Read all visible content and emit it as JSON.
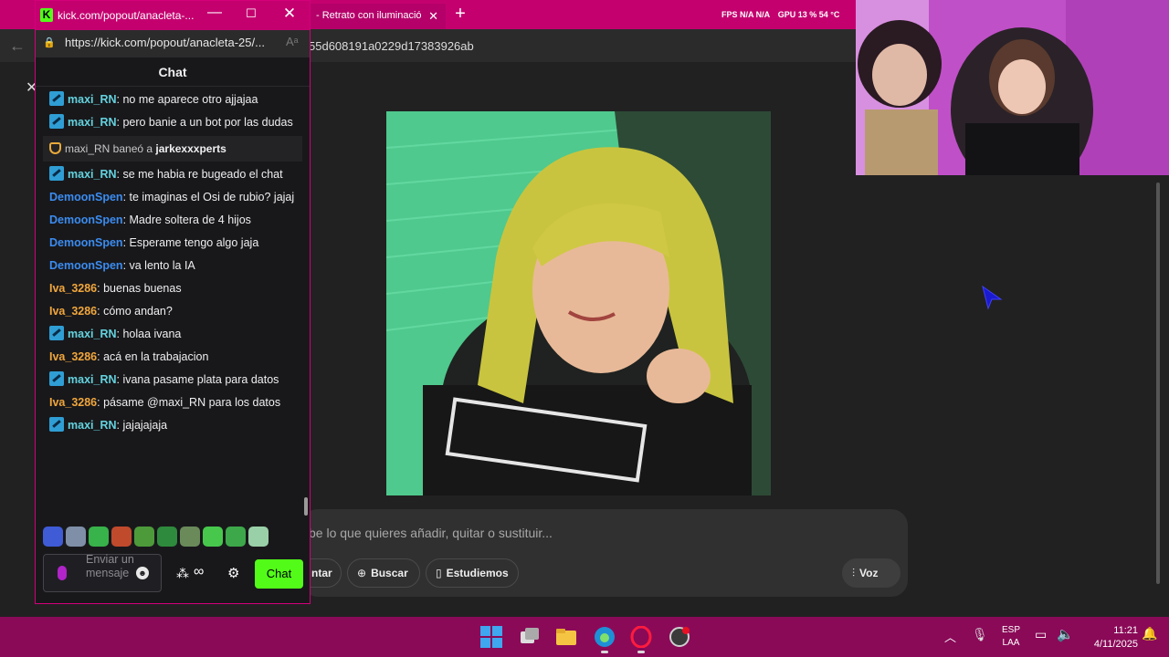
{
  "background_browser": {
    "tab_title": "- Retrato con iluminació",
    "perf_stats": [
      "FPS N/A N/A",
      "GPU 13 % 54 °C"
    ],
    "url_fragment": "55d608191a0229d17383926ab"
  },
  "prompt_bar": {
    "placeholder": "be lo que quieres añadir, quitar o sustituir...",
    "attach_label": "ntar",
    "search_label": "Buscar",
    "study_label": "Estudiemos",
    "voice_label": "Voz"
  },
  "popout": {
    "title": "kick.com/popout/anacleta-...",
    "url": "https://kick.com/popout/anacleta-25/...",
    "header": "Chat",
    "messages": [
      {
        "user": "maxi_RN",
        "text": ": no me aparece otro ajjajaa",
        "badge": true,
        "color": "#64d2de"
      },
      {
        "user": "maxi_RN",
        "text": ": pero banie a un bot por las dudas",
        "badge": true,
        "color": "#64d2de"
      },
      {
        "mod_action": true,
        "user": "maxi_RN",
        "action": " baneó a ",
        "target": "jarkexxxperts"
      },
      {
        "user": "maxi_RN",
        "text": ": se me habia re bugeado el chat",
        "badge": true,
        "color": "#64d2de"
      },
      {
        "user": "DemoonSpen",
        "text": ": te imaginas el Osi de rubio? jajaj",
        "badge": false,
        "color": "#3b8cf0"
      },
      {
        "user": "DemoonSpen",
        "text": ": Madre soltera de 4 hijos",
        "badge": false,
        "color": "#3b8cf0"
      },
      {
        "user": "DemoonSpen",
        "text": ": Esperame tengo algo jaja",
        "badge": false,
        "color": "#3b8cf0"
      },
      {
        "user": "DemoonSpen",
        "text": ": va lento la IA",
        "badge": false,
        "color": "#3b8cf0"
      },
      {
        "user": "Iva_3286",
        "text": ": buenas buenas",
        "badge": false,
        "color": "#f0a63c"
      },
      {
        "user": "Iva_3286",
        "text": ": cómo andan?",
        "badge": false,
        "color": "#f0a63c"
      },
      {
        "user": "maxi_RN",
        "text": ": holaa ivana",
        "badge": true,
        "color": "#64d2de"
      },
      {
        "user": "Iva_3286",
        "text": ": acá en la trabajacion",
        "badge": false,
        "color": "#f0a63c"
      },
      {
        "user": "maxi_RN",
        "text": ": ivana pasame plata para datos",
        "badge": true,
        "color": "#64d2de"
      },
      {
        "user": "Iva_3286",
        "text": ": pásame @maxi_RN para los datos",
        "badge": false,
        "color": "#f0a63c"
      },
      {
        "user": "maxi_RN",
        "text": ": jajajajaja",
        "badge": true,
        "color": "#64d2de"
      }
    ],
    "emotes": [
      "#3f5bd6",
      "#7f8fa8",
      "#38b24a",
      "#c04a2c",
      "#4d9a3a",
      "#2e8a3c",
      "#6a8a5a",
      "#47c84c",
      "#3da84a",
      "#9ad0a8"
    ],
    "input_placeholder": "Enviar un mensaje",
    "send_label": "Chat"
  },
  "taskbar": {
    "lang_top": "ESP",
    "lang_bottom": "LAA",
    "time": "11:21",
    "date": "4/11/2025"
  },
  "colors": {
    "kick_green": "#53fc18",
    "browser_frame": "#c4006f",
    "taskbar": "#8a0a58"
  }
}
